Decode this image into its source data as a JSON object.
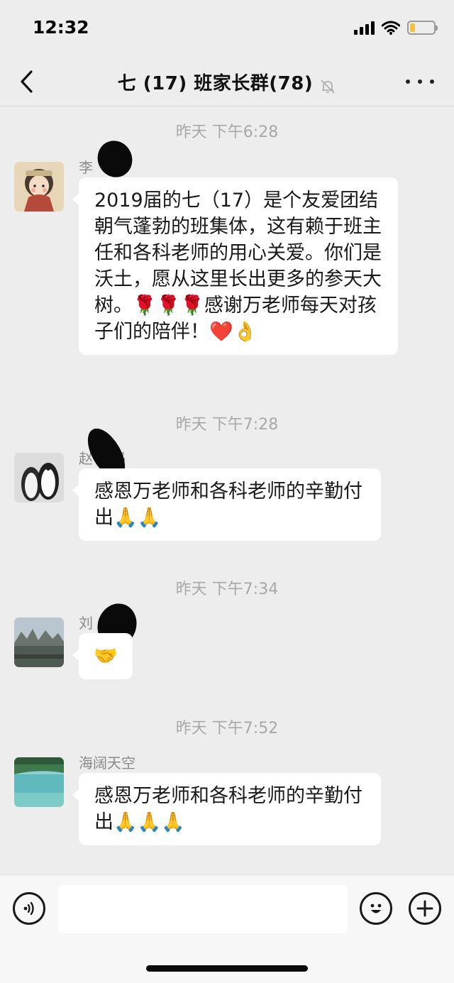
{
  "status_bar": {
    "time": "12:32"
  },
  "nav": {
    "title": "七 (17) 班家长群(78)"
  },
  "messages": [
    {
      "timestamp": "昨天 下午6:28",
      "sender": "李",
      "text": "2019届的七（17）是个友爱团结朝气蓬勃的班集体，这有赖于班主任和各科老师的用心关爱。你们是沃土，愿从这里长出更多的参天大树。🌹🌹🌹感谢万老师每天对孩子们的陪伴！❤️👌"
    },
    {
      "timestamp": "昨天 下午7:28",
      "sender": "赵    妈妈",
      "text": "感恩万老师和各科老师的辛勤付出🙏🙏"
    },
    {
      "timestamp": "昨天 下午7:34",
      "sender": "刘    爸爸",
      "text": "🤝"
    },
    {
      "timestamp": "昨天 下午7:52",
      "sender": "海阔天空",
      "text": "感恩万老师和各科老师的辛勤付出🙏🙏🙏"
    }
  ],
  "input_bar": {
    "input_value": ""
  },
  "colors": {
    "background": "#ededed",
    "bubble": "#ffffff",
    "timestamp_text": "#a8a8a8",
    "sender_text": "#8a8a8a",
    "battery_fill": "#f5c043"
  },
  "battery_level": 0.22,
  "icons": {
    "back": "chevron-left-icon",
    "mute": "bell-slash-icon",
    "more": "more-dots-icon",
    "voice": "voice-icon",
    "emoji": "emoji-icon",
    "plus": "plus-icon"
  }
}
